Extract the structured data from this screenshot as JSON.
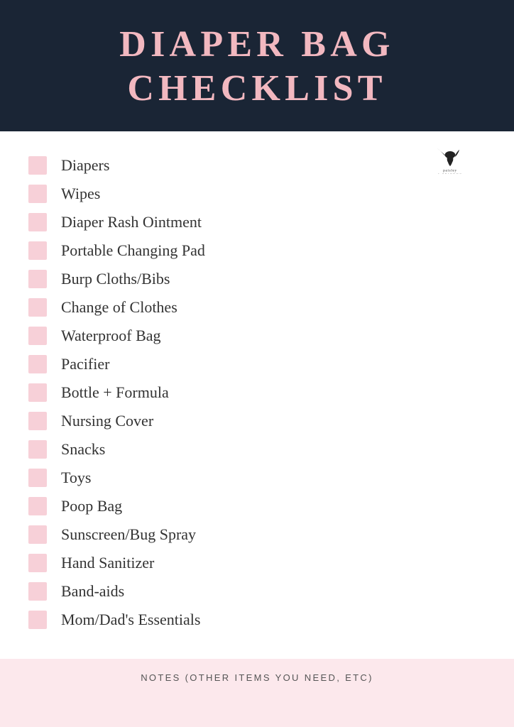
{
  "header": {
    "title_line1": "DIAPER BAG",
    "title_line2": "CHECKLIST"
  },
  "logo": {
    "alt": "Paisley + Sparrow logo"
  },
  "checklist": {
    "items": [
      {
        "id": 1,
        "label": "Diapers"
      },
      {
        "id": 2,
        "label": "Wipes"
      },
      {
        "id": 3,
        "label": "Diaper Rash Ointment"
      },
      {
        "id": 4,
        "label": "Portable Changing Pad"
      },
      {
        "id": 5,
        "label": "Burp Cloths/Bibs"
      },
      {
        "id": 6,
        "label": "Change of Clothes"
      },
      {
        "id": 7,
        "label": "Waterproof Bag"
      },
      {
        "id": 8,
        "label": "Pacifier"
      },
      {
        "id": 9,
        "label": "Bottle + Formula"
      },
      {
        "id": 10,
        "label": "Nursing Cover"
      },
      {
        "id": 11,
        "label": "Snacks"
      },
      {
        "id": 12,
        "label": "Toys"
      },
      {
        "id": 13,
        "label": "Poop Bag"
      },
      {
        "id": 14,
        "label": "Sunscreen/Bug Spray"
      },
      {
        "id": 15,
        "label": "Hand Sanitizer"
      },
      {
        "id": 16,
        "label": "Band-aids"
      },
      {
        "id": 17,
        "label": "Mom/Dad's Essentials"
      }
    ]
  },
  "notes": {
    "label": "NOTES (OTHER ITEMS YOU NEED, ETC)"
  },
  "colors": {
    "header_bg": "#1a2535",
    "title_color": "#f2b8c0",
    "checkbox_color": "#f7d0d8",
    "notes_bg": "#fce8ec"
  }
}
